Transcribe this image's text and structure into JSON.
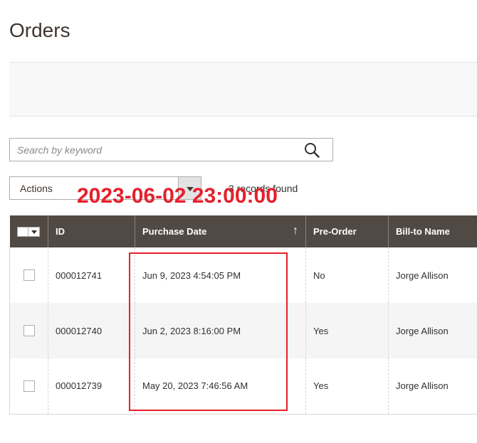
{
  "page": {
    "title": "Orders"
  },
  "search": {
    "placeholder": "Search by keyword",
    "value": ""
  },
  "toolbar": {
    "actions_label": "Actions",
    "records_found": "3 records found"
  },
  "overlay": {
    "timestamp": "2023-06-02 23:00:00",
    "color": "#e5202c"
  },
  "grid": {
    "columns": [
      "ID",
      "Purchase Date",
      "Pre-Order",
      "Bill-to Name"
    ],
    "sort_indicator": "↑",
    "rows": [
      {
        "id": "000012741",
        "purchase_date": "Jun 9, 2023 4:54:05 PM",
        "pre_order": "No",
        "bill_to": "Jorge Allison"
      },
      {
        "id": "000012740",
        "purchase_date": "Jun 2, 2023 8:16:00 PM",
        "pre_order": "Yes",
        "bill_to": "Jorge Allison"
      },
      {
        "id": "000012739",
        "purchase_date": "May 20, 2023 7:46:56 AM",
        "pre_order": "Yes",
        "bill_to": "Jorge Allison"
      }
    ]
  },
  "colors": {
    "header_bg": "#514943",
    "accent_red": "#e5202c",
    "panel_bg": "#f8f8f8"
  }
}
